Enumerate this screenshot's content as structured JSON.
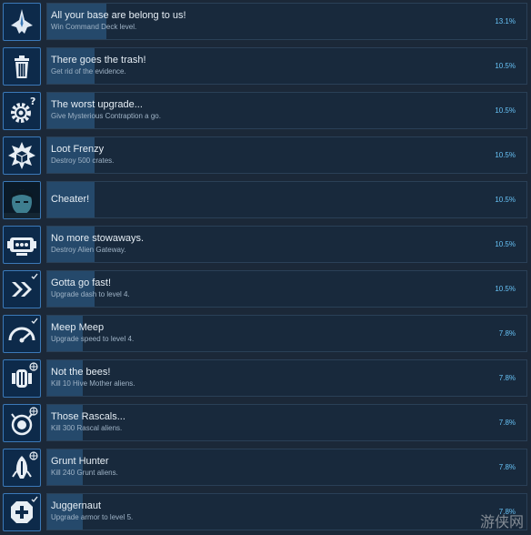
{
  "achievements": [
    {
      "title": "All your base are belong to us!",
      "desc": "Win Command Deck level.",
      "pct": "13.1%",
      "fill": 0.131,
      "icon": "fighter-ship-icon"
    },
    {
      "title": "There goes the trash!",
      "desc": "Get rid of the evidence.",
      "pct": "10.5%",
      "fill": 0.105,
      "icon": "trash-can-icon"
    },
    {
      "title": "The worst upgrade...",
      "desc": "Give Mysterious Contraption a go.",
      "pct": "10.5%",
      "fill": 0.105,
      "icon": "gear-question-icon"
    },
    {
      "title": "Loot Frenzy",
      "desc": "Destroy 500 crates.",
      "pct": "10.5%",
      "fill": 0.105,
      "icon": "exploding-crate-icon"
    },
    {
      "title": "Cheater!",
      "desc": "",
      "pct": "10.5%",
      "fill": 0.105,
      "icon": "face-portrait-icon"
    },
    {
      "title": "No more stowaways.",
      "desc": "Destroy Alien Gateway.",
      "pct": "10.5%",
      "fill": 0.105,
      "icon": "alien-gateway-icon"
    },
    {
      "title": "Gotta go fast!",
      "desc": "Upgrade dash to level 4.",
      "pct": "10.5%",
      "fill": 0.105,
      "icon": "dash-chevrons-icon"
    },
    {
      "title": "Meep Meep",
      "desc": "Upgrade speed to level 4.",
      "pct": "7.8%",
      "fill": 0.078,
      "icon": "speedometer-icon"
    },
    {
      "title": "Not the bees!",
      "desc": "Kill 10 Hive Mother aliens.",
      "pct": "7.8%",
      "fill": 0.078,
      "icon": "hive-mother-icon"
    },
    {
      "title": "Those Rascals...",
      "desc": "Kill 300 Rascal aliens.",
      "pct": "7.8%",
      "fill": 0.078,
      "icon": "rascal-alien-icon"
    },
    {
      "title": "Grunt Hunter",
      "desc": "Kill 240 Grunt aliens.",
      "pct": "7.8%",
      "fill": 0.078,
      "icon": "grunt-alien-icon"
    },
    {
      "title": "Juggernaut",
      "desc": "Upgrade armor to level 5.",
      "pct": "7.8%",
      "fill": 0.078,
      "icon": "armor-plus-icon"
    }
  ],
  "watermark": "游侠网",
  "colors": {
    "accent": "#66c0f4",
    "bar": "#25496b",
    "card": "#18293c",
    "icon_border": "#3b79b8"
  }
}
